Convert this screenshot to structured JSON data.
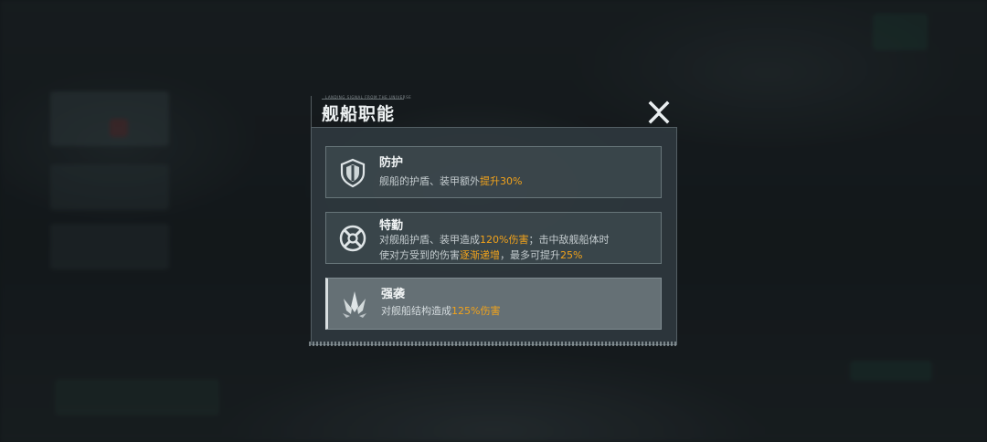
{
  "dialog": {
    "title": "舰船职能",
    "header_caption": "LANDING SIGNAL FROM THE UNIVERSE",
    "close_label": "X"
  },
  "roles": [
    {
      "name": "防护",
      "icon": "shield-icon",
      "desc_1": "舰船的护盾、装甲额外",
      "desc_hl_1": "提升30%"
    },
    {
      "name": "特勤",
      "icon": "crosshair-icon",
      "line1_a": "对舰船护盾、装甲造成",
      "line1_hl": "120%伤害",
      "line1_b": "；击中敌舰船体时",
      "line2_a": "使对方受到的伤害",
      "line2_hl": "逐渐递增",
      "line2_b": "，最多可提升",
      "line2_hl2": "25%"
    },
    {
      "name": "强袭",
      "icon": "spikes-icon",
      "desc_1": "对舰船结构造成",
      "desc_hl_1": "125%伤害",
      "selected": true
    }
  ],
  "colors": {
    "highlight": "#f2a31b",
    "panel": "#2e383d"
  }
}
